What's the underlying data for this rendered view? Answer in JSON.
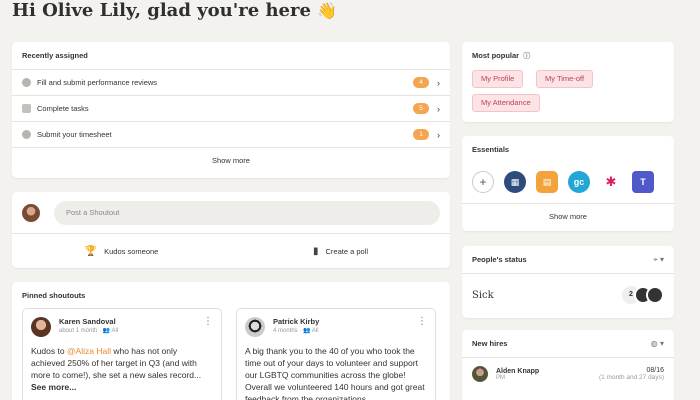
{
  "greeting": {
    "text": "Hi Olive Lily, glad you're here",
    "emoji": "👋"
  },
  "recent": {
    "title": "Recently assigned",
    "items": [
      {
        "label": "Fill and submit performance reviews",
        "count": "4"
      },
      {
        "label": "Complete tasks",
        "count": "5"
      },
      {
        "label": "Submit your timesheet",
        "count": "1"
      }
    ],
    "show_more": "Show more"
  },
  "shoutout": {
    "placeholder": "Post a Shoutout",
    "kudos": "Kudos someone",
    "poll": "Create a poll"
  },
  "pinned": {
    "title": "Pinned shoutouts",
    "posts": [
      {
        "name": "Karen Sandoval",
        "meta": "about 1 month",
        "audience": "All",
        "body_before": "Kudos to ",
        "mention": "@Aliza Hall",
        "body_after": " who has not only achieved 250% of her target in Q3 (and with more to come!), she set a new sales record...",
        "see_more": "See more..."
      },
      {
        "name": "Patrick Kirby",
        "meta": "4 months",
        "audience": "All",
        "body": "A big thank you to the 40 of you who took the time out of your days to volunteer and support our LGBTQ communities across the globe! Overall we volunteered 140 hours and got great feedback from the organizations"
      }
    ]
  },
  "popular": {
    "title": "Most popular",
    "chips": [
      "My Profile",
      "My Time-off",
      "My Attendance"
    ]
  },
  "essentials": {
    "title": "Essentials",
    "show_more": "Show more"
  },
  "status": {
    "title": "People's status",
    "value": "Sick",
    "count": "2"
  },
  "newhires": {
    "title": "New hires",
    "hire": {
      "name": "Alden Knapp",
      "role": "PM",
      "date": "08/16",
      "relative": "(1 month and 27 days)"
    }
  }
}
